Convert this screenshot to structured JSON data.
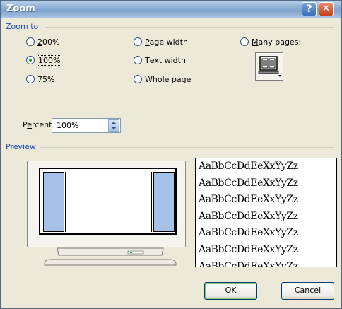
{
  "window": {
    "title": "Zoom",
    "help_glyph": "?",
    "close_glyph": "✕"
  },
  "zoom_to": {
    "group_label": "Zoom to",
    "options": [
      {
        "label": "200%",
        "accel": "2",
        "rest": "00%",
        "selected": false
      },
      {
        "label": "100%",
        "accel": "1",
        "rest": "00%",
        "selected": true
      },
      {
        "label": "75%",
        "accel": "7",
        "rest": "5%",
        "selected": false
      },
      {
        "label": "Page width",
        "accel": "P",
        "rest": "age width",
        "selected": false
      },
      {
        "label": "Text width",
        "accel": "T",
        "rest": "ext width",
        "selected": false
      },
      {
        "label": "Whole page",
        "accel": "W",
        "rest": "hole page",
        "selected": false
      },
      {
        "label": "Many pages:",
        "accel": "M",
        "rest": "any pages:",
        "selected": false
      }
    ],
    "many_pages_icon": "monitor-pages-icon"
  },
  "percent": {
    "label_pre": "P",
    "label_accel": "e",
    "label_post": "rcent:",
    "value": "100%"
  },
  "preview": {
    "group_label": "Preview",
    "sample_lines": [
      "AaBbCcDdEeXxYyZz",
      "AaBbCcDdEeXxYyZz",
      "AaBbCcDdEeXxYyZz",
      "AaBbCcDdEeXxYyZz",
      "AaBbCcDdEeXxYyZz",
      "AaBbCcDdEeXxYyZz",
      "AaBbCcDdEeXxYyZz"
    ]
  },
  "buttons": {
    "ok": "OK",
    "cancel": "Cancel"
  },
  "colors": {
    "accent": "#1c4bbd",
    "title_gradient": "#8fb0d6",
    "page_side": "#a5c1e8",
    "radio_dot": "#21a121"
  }
}
